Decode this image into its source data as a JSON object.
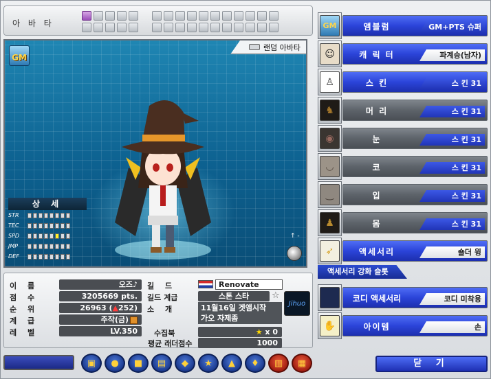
{
  "avatar_strip": {
    "title": "아 바 타"
  },
  "preview": {
    "badge": "GM",
    "random_avatar_label": "랜덤 아바타",
    "detail_title": "상 세",
    "stats": [
      {
        "label": "STR",
        "filled": 0,
        "total": 8
      },
      {
        "label": "TEC",
        "filled": 0,
        "total": 8
      },
      {
        "label": "SPD",
        "filled": 1,
        "total": 8,
        "highlight_index": 5
      },
      {
        "label": "JMP",
        "filled": 0,
        "total": 8
      },
      {
        "label": "DEF",
        "filled": 0,
        "total": 8
      }
    ]
  },
  "info": {
    "name_label": "이 름",
    "name_value": "오즈♪",
    "points_label": "점 수",
    "points_value": "3205669 pts.",
    "rank_label": "순 위",
    "rank_value": "26963 (",
    "rank_change": "252)",
    "grade_label": "계 급",
    "grade_value": "주작(금)",
    "level_label": "레 벨",
    "level_value": "LV.350",
    "guild_label": "길 드",
    "guild_value": "Renovate",
    "guild_grade_label": "길드 계급",
    "guild_grade_value": "스톤 스타",
    "intro_label": "소 개",
    "intro_line1": "11월16일 겟앰시작",
    "intro_line2": "가오 자제좀",
    "collection_label": "수집북",
    "collection_value": "x 0",
    "ladder_label": "평균 래더점수",
    "ladder_value": "1000",
    "emblem_text": "Jihuo"
  },
  "categories": [
    {
      "key": "emblem",
      "name": "앰블럼",
      "value": "GM+PTS 슈퍼 앰블럼",
      "icon": "gm-emblem-icon",
      "style": "blue"
    },
    {
      "key": "character",
      "name": "캐 릭 터",
      "value": "파계승(남자)",
      "icon": "character-face-icon",
      "style": "blue"
    },
    {
      "key": "skin",
      "name": "스   킨",
      "value": "스   킨 31",
      "icon": "skin-silhouette-icon",
      "style": "blue"
    },
    {
      "key": "hair",
      "name": "머   리",
      "value": "스   킨 31",
      "icon": "hair-icon",
      "style": "gray"
    },
    {
      "key": "eyes",
      "name": "눈",
      "value": "스   킨 31",
      "icon": "eyes-icon",
      "style": "gray"
    },
    {
      "key": "nose",
      "name": "코",
      "value": "스   킨 31",
      "icon": "nose-icon",
      "style": "gray"
    },
    {
      "key": "mouth",
      "name": "입",
      "value": "스   킨 31",
      "icon": "mouth-icon",
      "style": "gray"
    },
    {
      "key": "body",
      "name": "몸",
      "value": "스   킨 31",
      "icon": "body-icon",
      "style": "gray"
    },
    {
      "key": "accessory",
      "name": "액세서리",
      "value": "숄더 윙",
      "icon": "feather-icon",
      "style": "blue"
    },
    {
      "key": "codi",
      "name": "코디 액세서리",
      "value": "코디 미착용",
      "icon": "empty-slot-icon",
      "style": "blue"
    },
    {
      "key": "item",
      "name": "아이템",
      "value": "손",
      "icon": "hand-icon",
      "style": "blue"
    }
  ],
  "enhance_slot_label": "액세서리 강화 슬롯",
  "close_label": "닫 기",
  "toolbar_icons": [
    "box-icon",
    "speech-icon",
    "folder-icon",
    "card-icon",
    "shield-icon",
    "star-icon",
    "bag-icon",
    "bell-icon",
    "stats-icon",
    "book-icon"
  ]
}
